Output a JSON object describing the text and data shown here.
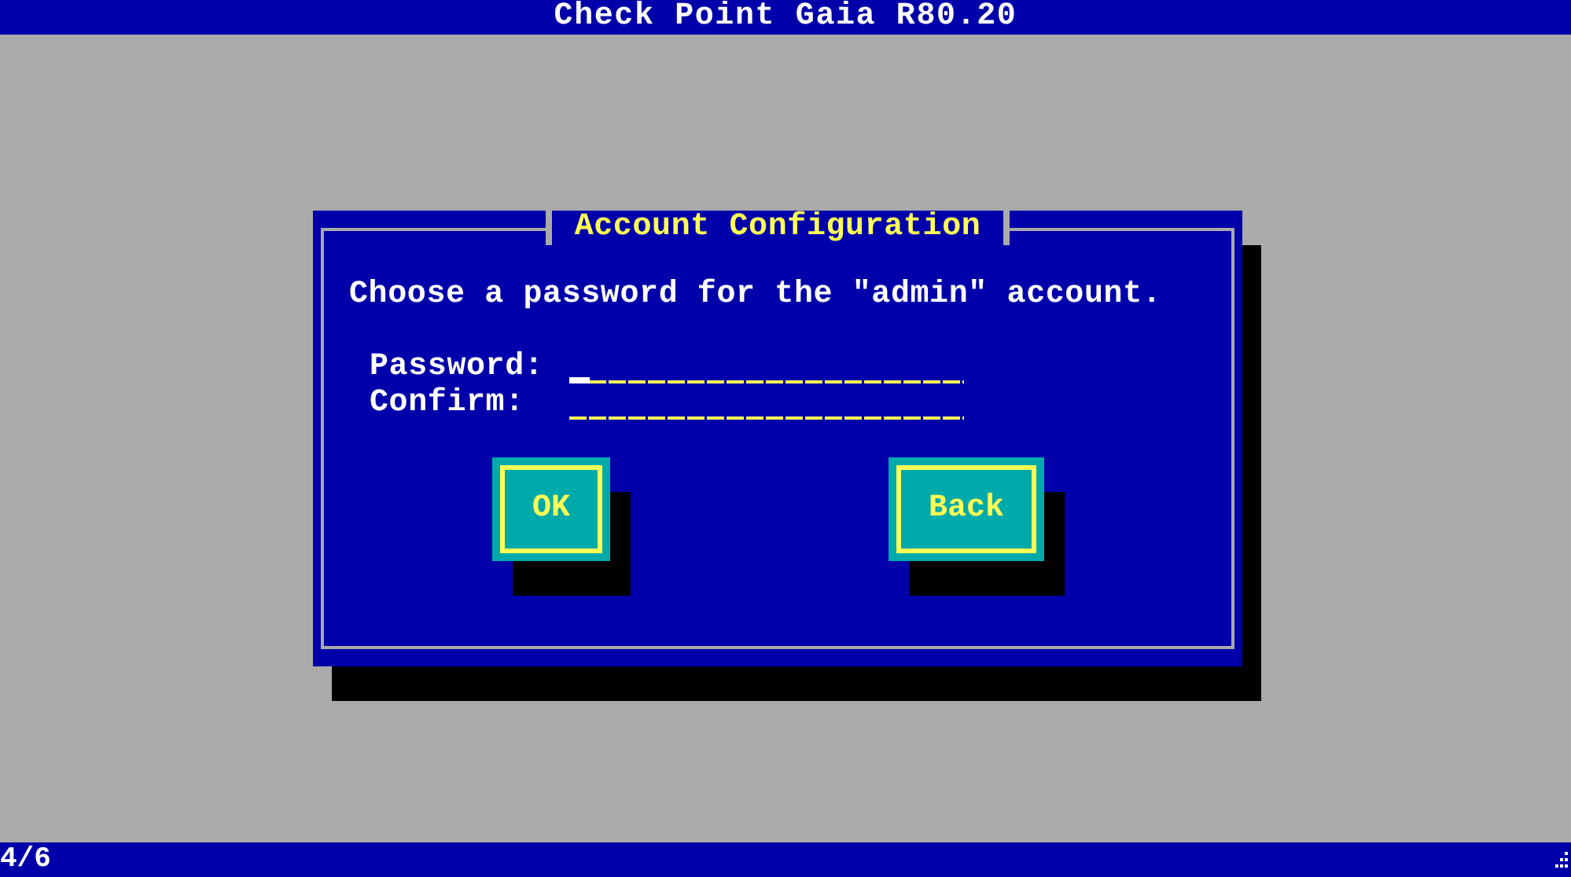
{
  "title_bar": {
    "title": "Check Point Gaia R80.20"
  },
  "dialog": {
    "title": "Account Configuration",
    "message": "Choose a password for the \"admin\" account.",
    "fields": [
      {
        "label": "Password:",
        "focused": true
      },
      {
        "label": "Confirm:",
        "focused": false
      }
    ],
    "buttons": [
      {
        "label": "OK"
      },
      {
        "label": "Back"
      }
    ]
  },
  "status_bar": {
    "step": "4/6"
  }
}
